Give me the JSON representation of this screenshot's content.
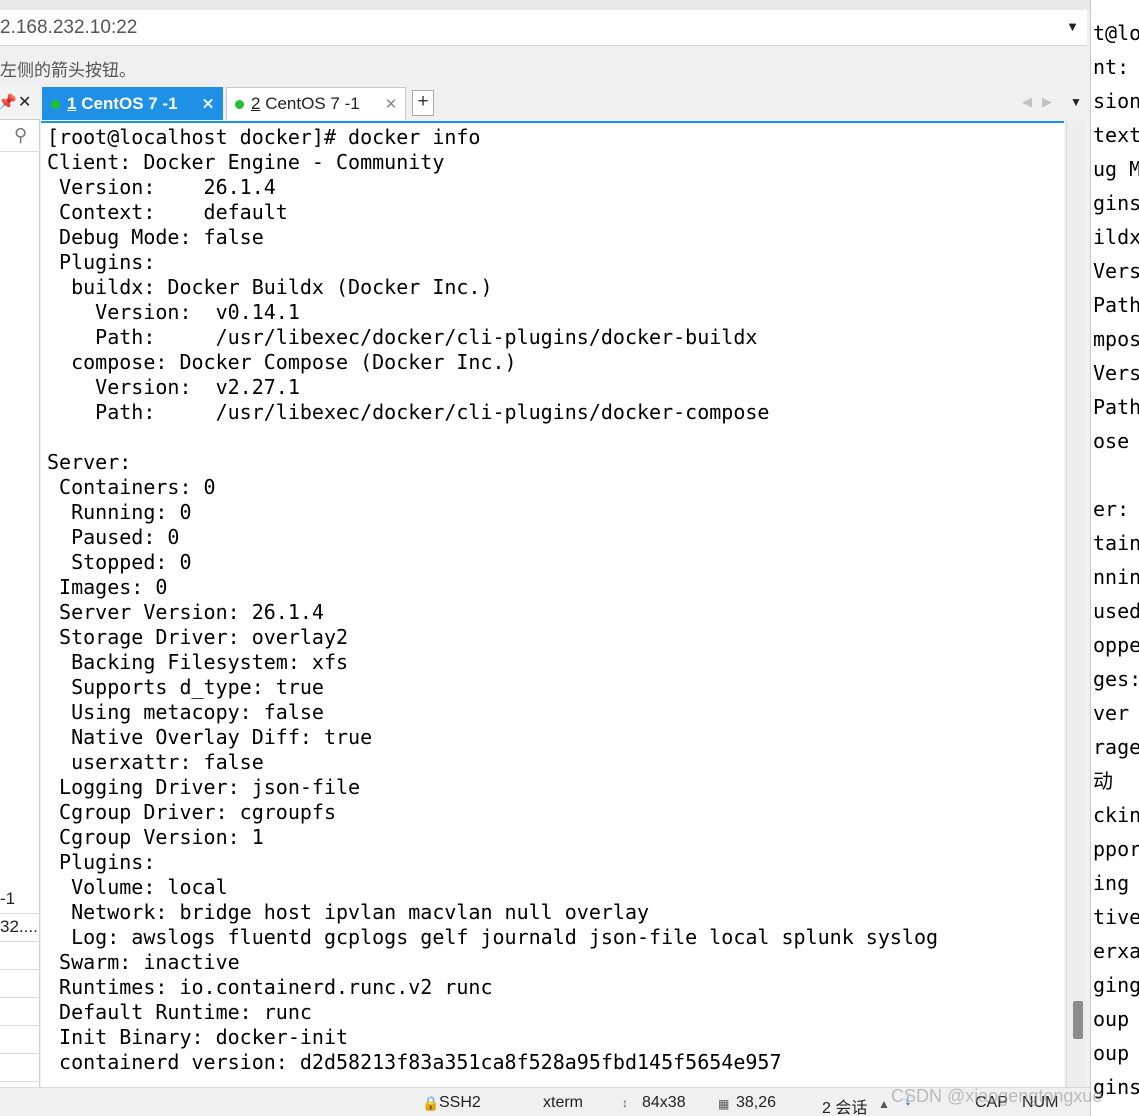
{
  "address_bar": {
    "host": "2.168.232.10:22"
  },
  "hint_text": "左侧的箭头按钮。",
  "left_panel": {
    "sessions": [
      "-1",
      "32...."
    ]
  },
  "tabs": [
    {
      "number": "1",
      "label": " CentOS 7 -1",
      "active": true
    },
    {
      "number": "2",
      "label": " CentOS 7 -1",
      "active": false
    }
  ],
  "terminal": {
    "lines": [
      "[root@localhost docker]# docker info",
      "Client: Docker Engine - Community",
      " Version:    26.1.4",
      " Context:    default",
      " Debug Mode: false",
      " Plugins:",
      "  buildx: Docker Buildx (Docker Inc.)",
      "    Version:  v0.14.1",
      "    Path:     /usr/libexec/docker/cli-plugins/docker-buildx",
      "  compose: Docker Compose (Docker Inc.)",
      "    Version:  v2.27.1",
      "    Path:     /usr/libexec/docker/cli-plugins/docker-compose",
      "",
      "Server:",
      " Containers: 0",
      "  Running: 0",
      "  Paused: 0",
      "  Stopped: 0",
      " Images: 0",
      " Server Version: 26.1.4",
      " Storage Driver: overlay2",
      "  Backing Filesystem: xfs",
      "  Supports d_type: true",
      "  Using metacopy: false",
      "  Native Overlay Diff: true",
      "  userxattr: false",
      " Logging Driver: json-file",
      " Cgroup Driver: cgroupfs",
      " Cgroup Version: 1",
      " Plugins:",
      "  Volume: local",
      "  Network: bridge host ipvlan macvlan null overlay",
      "  Log: awslogs fluentd gcplogs gelf journald json-file local splunk syslog",
      " Swarm: inactive",
      " Runtimes: io.containerd.runc.v2 runc",
      " Default Runtime: runc",
      " Init Binary: docker-init",
      " containerd version: d2d58213f83a351ca8f528a95fbd145f5654e957"
    ]
  },
  "status_bar": {
    "protocol": "SSH2",
    "terminal_type": "xterm",
    "size": "84x38",
    "cursor": "38,26",
    "sessions": "2 会话",
    "cap": "CAP",
    "num": "NUM"
  },
  "right_pane": {
    "lines": [
      "t@lo",
      "nt:",
      "sion",
      "text",
      "ug M",
      "gins",
      "ildx",
      "Vers",
      "Path",
      "mpos",
      "Vers",
      "Path",
      "ose",
      "",
      "er:",
      "tain",
      "nnin",
      "used",
      "oppe",
      "ges:",
      "ver",
      "rage",
      "动",
      "ckin",
      "ppor",
      "ing",
      "tive",
      "erxa",
      "ging",
      "oup",
      "oup",
      "gins"
    ]
  },
  "watermark": "CSDN @xiaogengtongxue"
}
